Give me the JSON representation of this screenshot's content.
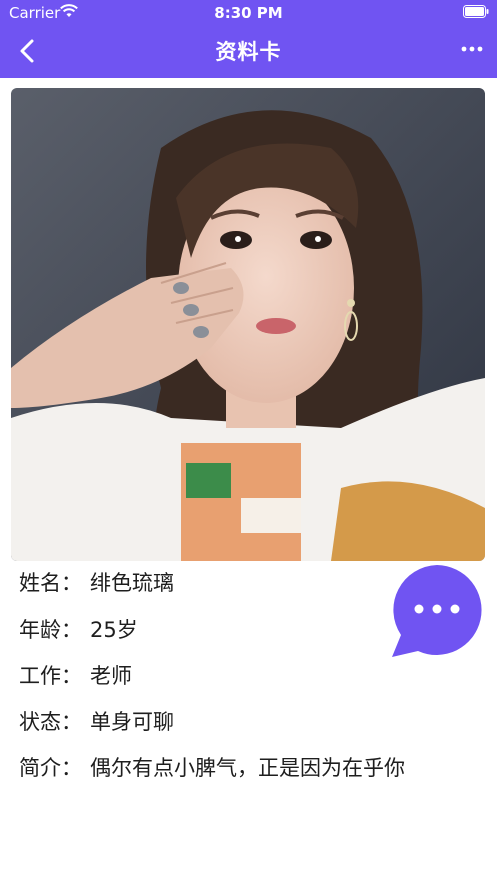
{
  "status_bar": {
    "carrier": "Carrier",
    "time": "8:30 PM",
    "wifi_icon": "wifi-icon",
    "battery_icon": "battery-icon"
  },
  "navbar": {
    "title": "资料卡",
    "back_icon": "chevron-left-icon",
    "more_icon": "more-horizontal-icon",
    "background_color": "#7054f2"
  },
  "profile": {
    "photo": "profile-photo",
    "fields": [
      {
        "label": "姓名：",
        "value": "绯色琉璃"
      },
      {
        "label": "年龄：",
        "value": "25岁"
      },
      {
        "label": "工作：",
        "value": "老师"
      },
      {
        "label": "状态：",
        "value": "单身可聊"
      },
      {
        "label": "简介：",
        "value": "偶尔有点小脾气，正是因为在乎你"
      }
    ]
  },
  "chat_button": {
    "icon": "chat-bubble-icon",
    "color": "#7054f2"
  }
}
